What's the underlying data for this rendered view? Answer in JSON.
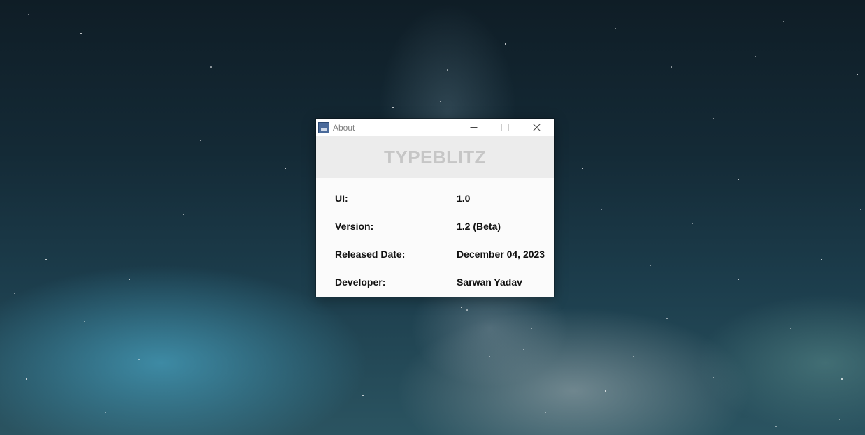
{
  "window": {
    "title": "About",
    "brand": "TYPEBLITZ",
    "icons": {
      "app": "app-icon",
      "minimize": "minimize-icon",
      "maximize": "maximize-icon",
      "close": "close-icon"
    }
  },
  "info": [
    {
      "label": "UI:",
      "value": "1.0"
    },
    {
      "label": "Version:",
      "value": "1.2 (Beta)"
    },
    {
      "label": "Released Date:",
      "value": "December 04, 2023"
    },
    {
      "label": "Developer:",
      "value": "Sarwan Yadav"
    }
  ],
  "colors": {
    "header_band": "#ececec",
    "brand_text": "#c6c6c6",
    "window_bg": "#fbfbfb"
  }
}
